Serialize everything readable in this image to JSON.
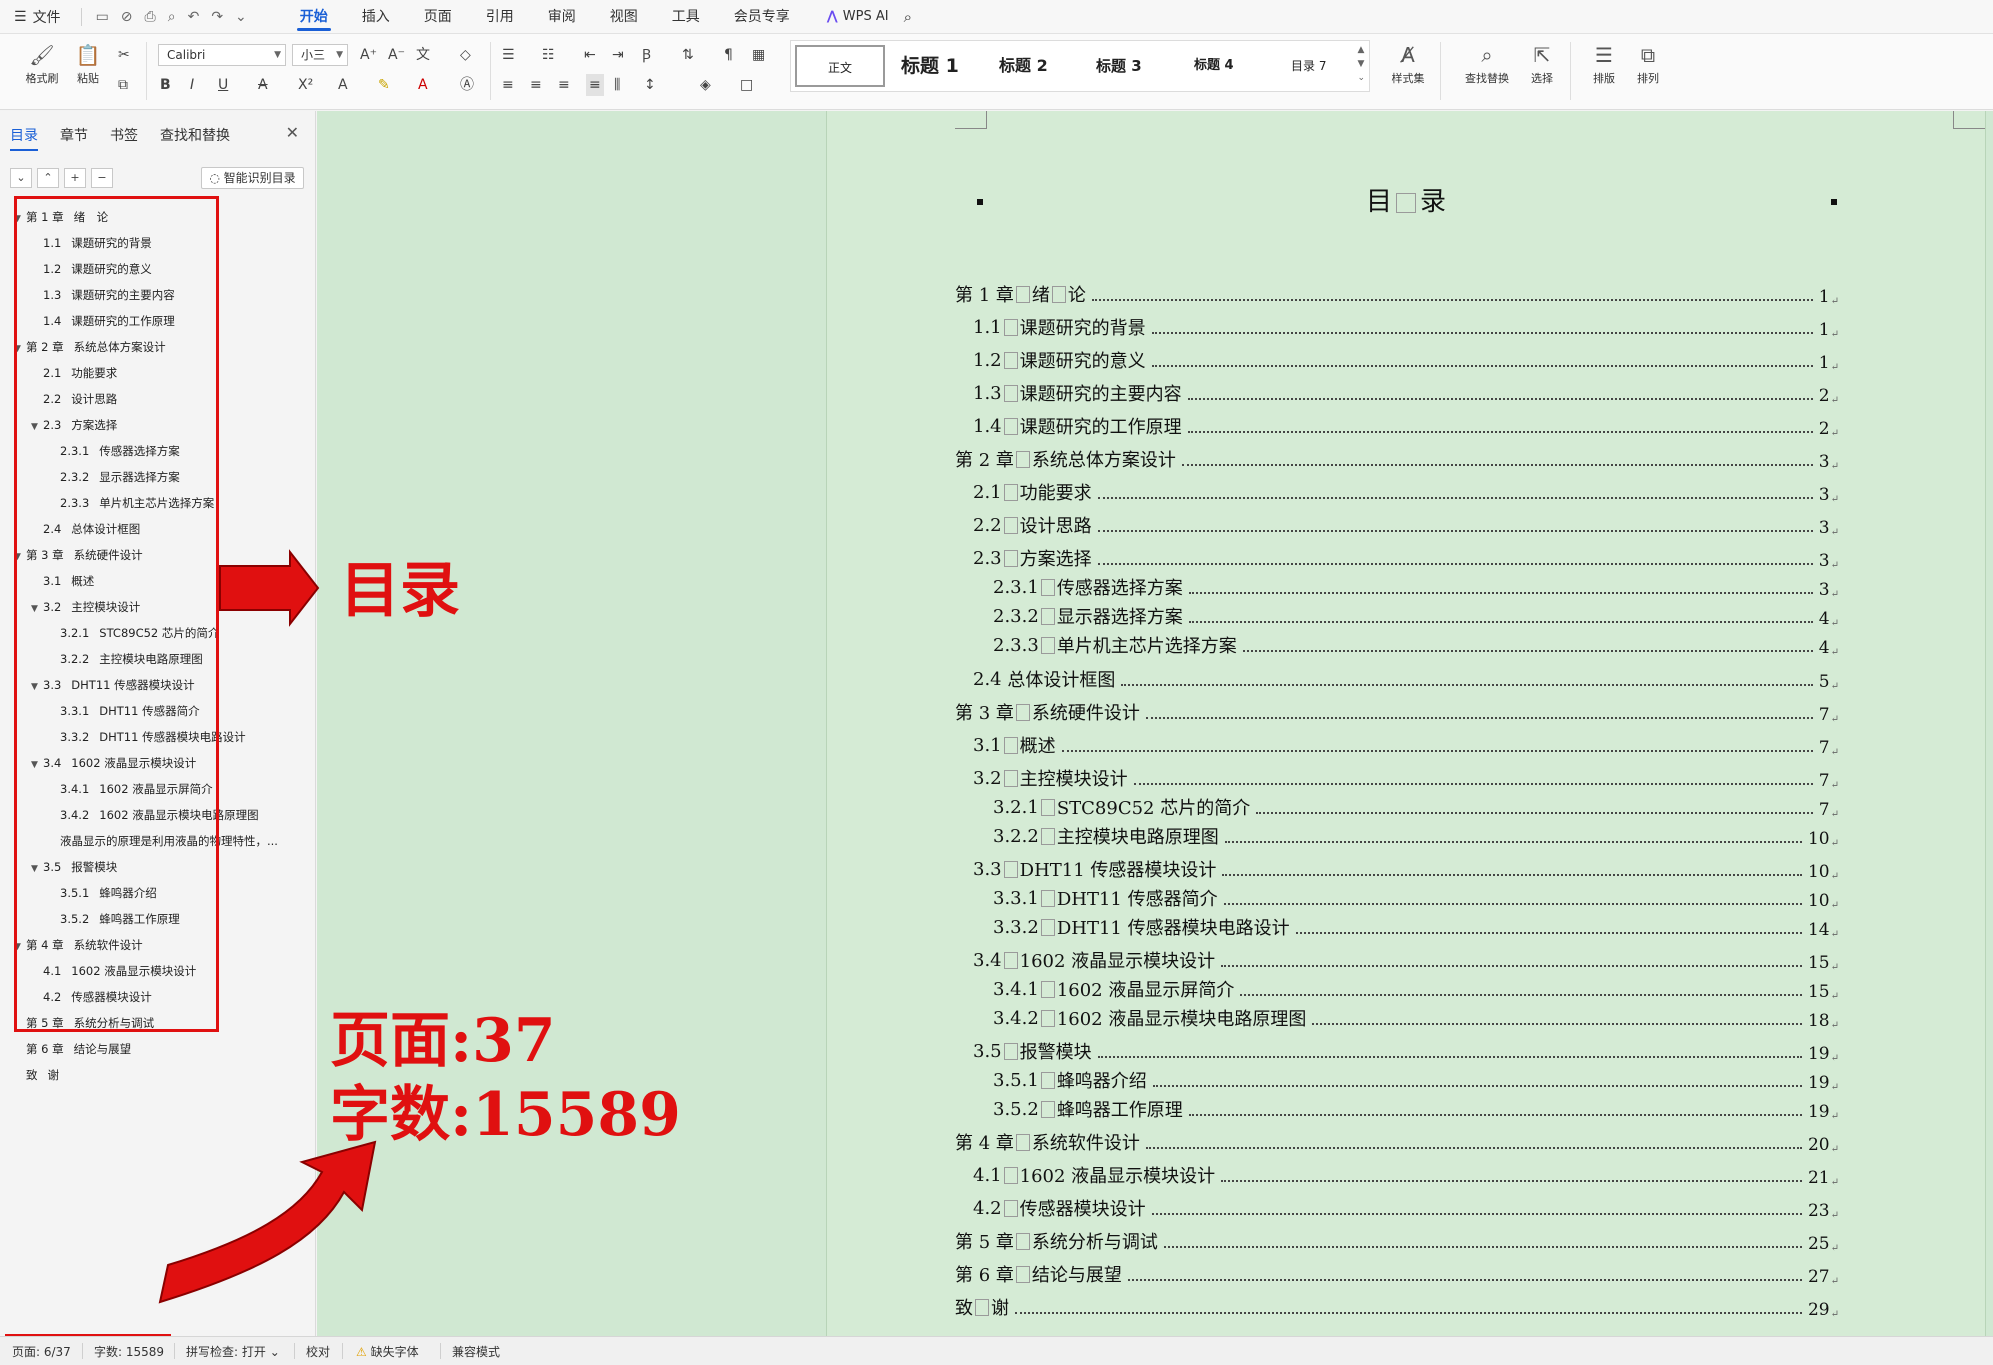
{
  "menubar": {
    "file_label": "文件",
    "tabs": [
      "开始",
      "插入",
      "页面",
      "引用",
      "审阅",
      "视图",
      "工具",
      "会员专享"
    ],
    "active_tab": "开始",
    "wps_ai_label": "WPS AI"
  },
  "ribbon": {
    "format_painter": "格式刷",
    "paste": "粘贴",
    "font_name": "Calibri",
    "font_size": "小三",
    "styles": [
      "正文",
      "标题 1",
      "标题 2",
      "标题 3",
      "标题 4",
      "目录 7"
    ],
    "style_set": "样式集",
    "find_replace": "查找替换",
    "select": "选择",
    "layout": "排版",
    "arrange": "排列"
  },
  "nav": {
    "tabs": [
      "目录",
      "章节",
      "书签",
      "查找和替换"
    ],
    "smart_toc_label": "智能识别目录",
    "tree": [
      {
        "num": "第 1 章",
        "text": "绪　论",
        "level": 0,
        "arrow": "▼"
      },
      {
        "num": "1.1",
        "text": "课题研究的背景",
        "level": 1,
        "arrow": ""
      },
      {
        "num": "1.2",
        "text": "课题研究的意义",
        "level": 1,
        "arrow": ""
      },
      {
        "num": "1.3",
        "text": "课题研究的主要内容",
        "level": 1,
        "arrow": ""
      },
      {
        "num": "1.4",
        "text": "课题研究的工作原理",
        "level": 1,
        "arrow": ""
      },
      {
        "num": "第 2 章",
        "text": "系统总体方案设计",
        "level": 0,
        "arrow": "▼"
      },
      {
        "num": "2.1",
        "text": "功能要求",
        "level": 1,
        "arrow": ""
      },
      {
        "num": "2.2",
        "text": "设计思路",
        "level": 1,
        "arrow": ""
      },
      {
        "num": "2.3",
        "text": "方案选择",
        "level": 1,
        "arrow": "▼"
      },
      {
        "num": "2.3.1",
        "text": "传感器选择方案",
        "level": 2,
        "arrow": ""
      },
      {
        "num": "2.3.2",
        "text": "显示器选择方案",
        "level": 2,
        "arrow": ""
      },
      {
        "num": "2.3.3",
        "text": "单片机主芯片选择方案",
        "level": 2,
        "arrow": ""
      },
      {
        "num": "2.4",
        "text": "总体设计框图",
        "level": 1,
        "arrow": ""
      },
      {
        "num": "第 3 章",
        "text": "系统硬件设计",
        "level": 0,
        "arrow": "▼"
      },
      {
        "num": "3.1",
        "text": "概述",
        "level": 1,
        "arrow": ""
      },
      {
        "num": "3.2",
        "text": "主控模块设计",
        "level": 1,
        "arrow": "▼"
      },
      {
        "num": "3.2.1",
        "text": "STC89C52 芯片的简介",
        "level": 2,
        "arrow": ""
      },
      {
        "num": "3.2.2",
        "text": "主控模块电路原理图",
        "level": 2,
        "arrow": ""
      },
      {
        "num": "3.3",
        "text": "DHT11 传感器模块设计",
        "level": 1,
        "arrow": "▼"
      },
      {
        "num": "3.3.1",
        "text": "DHT11 传感器简介",
        "level": 2,
        "arrow": ""
      },
      {
        "num": "3.3.2",
        "text": "DHT11 传感器模块电路设计",
        "level": 2,
        "arrow": ""
      },
      {
        "num": "3.4",
        "text": "1602 液晶显示模块设计",
        "level": 1,
        "arrow": "▼"
      },
      {
        "num": "3.4.1",
        "text": "1602 液晶显示屏简介",
        "level": 2,
        "arrow": ""
      },
      {
        "num": "3.4.2",
        "text": "1602 液晶显示模块电路原理图",
        "level": 2,
        "arrow": ""
      },
      {
        "num": "",
        "text": "液晶显示的原理是利用液晶的物理特性，...",
        "level": 2,
        "arrow": ""
      },
      {
        "num": "3.5",
        "text": "报警模块",
        "level": 1,
        "arrow": "▼"
      },
      {
        "num": "3.5.1",
        "text": "蜂鸣器介绍",
        "level": 2,
        "arrow": ""
      },
      {
        "num": "3.5.2",
        "text": "蜂鸣器工作原理",
        "level": 2,
        "arrow": ""
      },
      {
        "num": "第 4 章",
        "text": "系统软件设计",
        "level": 0,
        "arrow": "▼"
      },
      {
        "num": "4.1",
        "text": "1602 液晶显示模块设计",
        "level": 1,
        "arrow": ""
      },
      {
        "num": "4.2",
        "text": "传感器模块设计",
        "level": 1,
        "arrow": ""
      },
      {
        "num": "第 5 章",
        "text": "系统分析与调试",
        "level": 0,
        "arrow": ""
      },
      {
        "num": "第 6 章",
        "text": "结论与展望",
        "level": 0,
        "arrow": ""
      },
      {
        "num": "致",
        "text": "谢",
        "level": 0,
        "arrow": ""
      }
    ]
  },
  "document": {
    "title_left": "目",
    "title_right": "录",
    "toc": [
      {
        "pre": "第 1 章",
        "text": "绪",
        "text2": "论",
        "page": "1",
        "indent": 0
      },
      {
        "pre": "1.1",
        "text": "课题研究的背景",
        "page": "1",
        "indent": 1
      },
      {
        "pre": "1.2",
        "text": "课题研究的意义",
        "page": "1",
        "indent": 1
      },
      {
        "pre": "1.3",
        "text": "课题研究的主要内容",
        "page": "2",
        "indent": 1
      },
      {
        "pre": "1.4",
        "text": "课题研究的工作原理",
        "page": "2",
        "indent": 1
      },
      {
        "pre": "第 2 章",
        "text": "系统总体方案设计",
        "page": "3",
        "indent": 0
      },
      {
        "pre": "2.1",
        "text": "功能要求",
        "page": "3",
        "indent": 1
      },
      {
        "pre": "2.2",
        "text": "设计思路",
        "page": "3",
        "indent": 1
      },
      {
        "pre": "2.3",
        "text": "方案选择",
        "page": "3",
        "indent": 1
      },
      {
        "pre": "2.3.1",
        "text": "传感器选择方案",
        "page": "3",
        "indent": 2
      },
      {
        "pre": "2.3.2",
        "text": "显示器选择方案",
        "page": "4",
        "indent": 2
      },
      {
        "pre": "2.3.3",
        "text": "单片机主芯片选择方案",
        "page": "4",
        "indent": 2
      },
      {
        "pre": "2.4",
        "text": "总体设计框图",
        "page": "5",
        "indent": 1,
        "nobox": true
      },
      {
        "pre": "第 3 章",
        "text": "系统硬件设计",
        "page": "7",
        "indent": 0
      },
      {
        "pre": "3.1",
        "text": "概述",
        "page": "7",
        "indent": 1
      },
      {
        "pre": "3.2",
        "text": "主控模块设计",
        "page": "7",
        "indent": 1
      },
      {
        "pre": "3.2.1",
        "text": "STC89C52 芯片的简介",
        "page": "7",
        "indent": 2
      },
      {
        "pre": "3.2.2",
        "text": "主控模块电路原理图",
        "page": "10",
        "indent": 2
      },
      {
        "pre": "3.3",
        "text": "DHT11 传感器模块设计",
        "page": "10",
        "indent": 1
      },
      {
        "pre": "3.3.1",
        "text": "DHT11 传感器简介",
        "page": "10",
        "indent": 2
      },
      {
        "pre": "3.3.2",
        "text": "DHT11 传感器模块电路设计",
        "page": "14",
        "indent": 2
      },
      {
        "pre": "3.4",
        "text": "1602 液晶显示模块设计",
        "page": "15",
        "indent": 1
      },
      {
        "pre": "3.4.1",
        "text": "1602 液晶显示屏简介",
        "page": "15",
        "indent": 2
      },
      {
        "pre": "3.4.2",
        "text": "1602 液晶显示模块电路原理图",
        "page": "18",
        "indent": 2
      },
      {
        "pre": "3.5",
        "text": "报警模块",
        "page": "19",
        "indent": 1
      },
      {
        "pre": "3.5.1",
        "text": "蜂鸣器介绍",
        "page": "19",
        "indent": 2
      },
      {
        "pre": "3.5.2",
        "text": "蜂鸣器工作原理",
        "page": "19",
        "indent": 2
      },
      {
        "pre": "第 4 章",
        "text": "系统软件设计",
        "page": "20",
        "indent": 0
      },
      {
        "pre": "4.1",
        "text": "1602 液晶显示模块设计",
        "page": "21",
        "indent": 1
      },
      {
        "pre": "4.2",
        "text": "传感器模块设计",
        "page": "23",
        "indent": 1
      },
      {
        "pre": "第 5 章",
        "text": "系统分析与调试",
        "page": "25",
        "indent": 0
      },
      {
        "pre": "第 6 章",
        "text": "结论与展望",
        "page": "27",
        "indent": 0
      },
      {
        "pre": "致",
        "text": "谢",
        "page": "29",
        "indent": 0
      }
    ]
  },
  "annotations": {
    "toc_label": "目录",
    "pages_label": "页面:37",
    "words_label": "字数:15589",
    "color": "#e01010"
  },
  "statusbar": {
    "page": "页面: 6/37",
    "words": "字数: 15589",
    "spell": "拼写检查: 打开",
    "proof": "校对",
    "missing_font": "缺失字体",
    "compat": "兼容模式"
  }
}
